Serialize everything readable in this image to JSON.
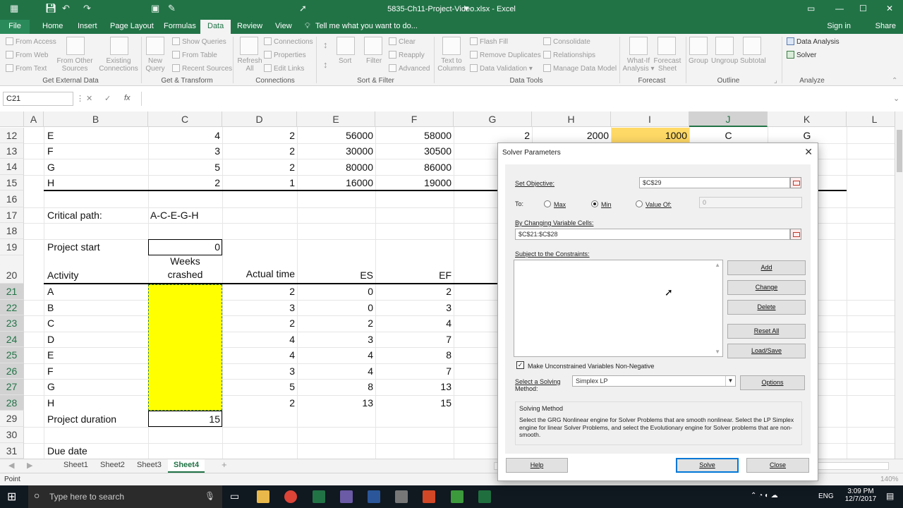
{
  "window": {
    "title": "5835-Ch11-Project-Video.xlsx - Excel",
    "controls": {
      "minimize": "—",
      "maximize": "☐",
      "close": "✕"
    }
  },
  "tabs": {
    "file": "File",
    "home": "Home",
    "insert": "Insert",
    "page_layout": "Page Layout",
    "formulas": "Formulas",
    "data": "Data",
    "review": "Review",
    "view": "View",
    "tell_me": "Tell me what you want to do...",
    "sign_in": "Sign in",
    "share": "Share"
  },
  "ribbon": {
    "get_external": {
      "from_access": "From Access",
      "from_web": "From Web",
      "from_text": "From Text",
      "from_other_l1": "From Other",
      "from_other_l2": "Sources",
      "existing_l1": "Existing",
      "existing_l2": "Connections",
      "label": "Get External Data"
    },
    "get_transform": {
      "new_query_l1": "New",
      "new_query_l2": "Query",
      "show_queries": "Show Queries",
      "from_table": "From Table",
      "recent_sources": "Recent Sources",
      "label": "Get & Transform"
    },
    "connections": {
      "refresh_l1": "Refresh",
      "refresh_l2": "All",
      "connections": "Connections",
      "properties": "Properties",
      "edit_links": "Edit Links",
      "label": "Connections"
    },
    "sort_filter": {
      "sort": "Sort",
      "filter": "Filter",
      "clear": "Clear",
      "reapply": "Reapply",
      "advanced": "Advanced",
      "label": "Sort & Filter"
    },
    "data_tools": {
      "text_to_columns_l1": "Text to",
      "text_to_columns_l2": "Columns",
      "flash_fill": "Flash Fill",
      "remove_duplicates": "Remove Duplicates",
      "data_validation": "Data Validation",
      "consolidate": "Consolidate",
      "relationships": "Relationships",
      "manage_model": "Manage Data Model",
      "label": "Data Tools"
    },
    "forecast": {
      "what_if_l1": "What-If",
      "what_if_l2": "Analysis",
      "forecast_sheet_l1": "Forecast",
      "forecast_sheet_l2": "Sheet",
      "label": "Forecast"
    },
    "outline": {
      "group": "Group",
      "ungroup": "Ungroup",
      "subtotal": "Subtotal",
      "label": "Outline"
    },
    "analyze": {
      "data_analysis": "Data Analysis",
      "solver": "Solver",
      "label": "Analyze"
    }
  },
  "formula_bar": {
    "name_box": "C21",
    "cancel": "✕",
    "enter": "✓",
    "fx": "fx",
    "formula": ""
  },
  "columns": [
    "A",
    "B",
    "C",
    "D",
    "E",
    "F",
    "G",
    "H",
    "I",
    "J",
    "K",
    "L"
  ],
  "rows": {
    "r12": {
      "num": "12",
      "B": "E",
      "C": "4",
      "D": "2",
      "E": "56000",
      "F": "58000",
      "G": "2",
      "H": "2000",
      "I": "1000",
      "J": "C",
      "K": "G"
    },
    "r13": {
      "num": "13",
      "B": "F",
      "C": "3",
      "D": "2",
      "E": "30000",
      "F": "30500"
    },
    "r14": {
      "num": "14",
      "B": "G",
      "C": "5",
      "D": "2",
      "E": "80000",
      "F": "86000"
    },
    "r15": {
      "num": "15",
      "B": "H",
      "C": "2",
      "D": "1",
      "E": "16000",
      "F": "19000"
    },
    "r16": {
      "num": "16"
    },
    "r17": {
      "num": "17",
      "B": "Critical path:",
      "C": "A-C-E-G-H"
    },
    "r18": {
      "num": "18"
    },
    "r19": {
      "num": "19",
      "B": "Project start",
      "C": "0"
    },
    "r20": {
      "num": "20",
      "B": "Activity",
      "C_l1": "Weeks",
      "C_l2": "crashed",
      "D": "Actual time",
      "E": "ES",
      "F": "EF"
    },
    "r21": {
      "num": "21",
      "B": "A",
      "D": "2",
      "E": "0",
      "F": "2"
    },
    "r22": {
      "num": "22",
      "B": "B",
      "D": "3",
      "E": "0",
      "F": "3"
    },
    "r23": {
      "num": "23",
      "B": "C",
      "D": "2",
      "E": "2",
      "F": "4"
    },
    "r24": {
      "num": "24",
      "B": "D",
      "D": "4",
      "E": "3",
      "F": "7"
    },
    "r25": {
      "num": "25",
      "B": "E",
      "D": "4",
      "E": "4",
      "F": "8"
    },
    "r26": {
      "num": "26",
      "B": "F",
      "D": "3",
      "E": "4",
      "F": "7"
    },
    "r27": {
      "num": "27",
      "B": "G",
      "D": "5",
      "E": "8",
      "F": "13"
    },
    "r28": {
      "num": "28",
      "B": "H",
      "D": "2",
      "E": "13",
      "F": "15"
    },
    "r29": {
      "num": "29",
      "B": "Project duration",
      "C": "15"
    },
    "r30": {
      "num": "30"
    },
    "r31": {
      "num": "31",
      "B": "Due date"
    }
  },
  "colors": {
    "excel_green": "#217346",
    "highlight_yellow": "#ffff00",
    "orange_fill": "#ffd966"
  },
  "sheet_tabs": {
    "s1": "Sheet1",
    "s2": "Sheet2",
    "s3": "Sheet3",
    "s4": "Sheet4",
    "add": "+"
  },
  "status": {
    "mode": "Point",
    "zoom": "140%"
  },
  "taskbar": {
    "search": "Type here to search",
    "lang": "ENG",
    "time": "3:09 PM",
    "date": "12/7/2017"
  },
  "solver": {
    "title": "Solver Parameters",
    "set_objective_label": "Set Objective:",
    "objective_value": "$C$29",
    "to_label": "To:",
    "max": "Max",
    "min": "Min",
    "value_of": "Value Of:",
    "value_of_value": "0",
    "selected_goal": "Min",
    "changing_label": "By Changing Variable Cells:",
    "changing_value": "$C$21:$C$28",
    "constraints_label": "Subject to the Constraints:",
    "add": "Add",
    "change": "Change",
    "delete": "Delete",
    "reset_all": "Reset All",
    "load_save": "Load/Save",
    "nonneg_label": "Make Unconstrained Variables Non-Negative",
    "nonneg_checked": true,
    "method_label_l1": "Select a Solving",
    "method_label_l2": "Method:",
    "method_value": "Simplex LP",
    "options": "Options",
    "method_group_title": "Solving Method",
    "method_desc": "Select the GRG Nonlinear engine for Solver Problems that are smooth nonlinear. Select the LP Simplex engine for linear Solver Problems, and select the Evolutionary engine for Solver problems that are non-smooth.",
    "help": "Help",
    "solve": "Solve",
    "close": "Close"
  }
}
